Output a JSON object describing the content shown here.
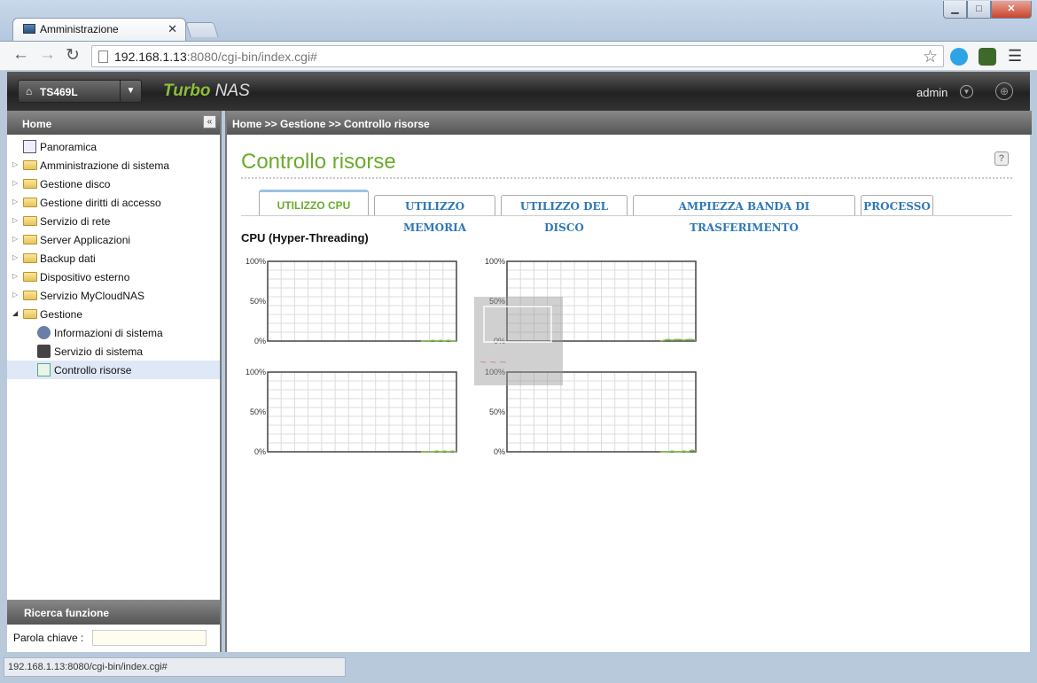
{
  "browser": {
    "tab_title": "Amministrazione",
    "tab_close": "✕",
    "url_host": "192.168.1.13",
    "url_rest": ":8080/cgi-bin/index.cgi#",
    "status_url": "192.168.1.13:8080/cgi-bin/index.cgi#"
  },
  "header": {
    "model": "TS469L",
    "brand_a": "Turbo",
    "brand_b": " NAS",
    "user": "admin"
  },
  "sidebar": {
    "title": "Home",
    "items": [
      {
        "label": "Panoramica"
      },
      {
        "label": "Amministrazione di sistema"
      },
      {
        "label": "Gestione disco"
      },
      {
        "label": "Gestione diritti di accesso"
      },
      {
        "label": "Servizio di rete"
      },
      {
        "label": "Server Applicazioni"
      },
      {
        "label": "Backup dati"
      },
      {
        "label": "Dispositivo esterno"
      },
      {
        "label": "Servizio MyCloudNAS"
      },
      {
        "label": "Gestione"
      },
      {
        "label": "Informazioni di sistema"
      },
      {
        "label": "Servizio di sistema"
      },
      {
        "label": "Controllo risorse"
      }
    ],
    "search_title": "Ricerca funzione",
    "keyword_label": "Parola chiave :"
  },
  "main": {
    "breadcrumb": "Home >> Gestione >> Controllo risorse",
    "title": "Controllo risorse",
    "tabs": [
      {
        "label": "UTILIZZO CPU"
      },
      {
        "label": "UTILIZZO MEMORIA"
      },
      {
        "label": "UTILIZZO DEL DISCO"
      },
      {
        "label": "AMPIEZZA BANDA DI TRASFERIMENTO"
      },
      {
        "label": "PROCESSO"
      }
    ],
    "section": "CPU (Hyper-Threading)"
  },
  "chart_data": {
    "type": "line",
    "title": "CPU (Hyper-Threading)",
    "y_ticks": [
      "100%",
      "50%",
      "0%"
    ],
    "ylim": [
      0,
      100
    ],
    "grid": true,
    "series": [
      {
        "values": [
          0,
          0,
          0,
          1,
          0,
          1,
          0,
          1,
          0,
          0
        ]
      },
      {
        "values": [
          0,
          1,
          2,
          1,
          2,
          2,
          1,
          2,
          2,
          1
        ]
      },
      {
        "values": [
          0,
          0,
          0,
          0,
          1,
          0,
          1,
          0,
          1,
          0
        ]
      },
      {
        "values": [
          0,
          0,
          0,
          1,
          0,
          0,
          1,
          0,
          2,
          1
        ]
      }
    ]
  },
  "colors": {
    "accent_green": "#6bab2b",
    "tab_blue": "#2f78b7",
    "line_green": "#7fc04b"
  }
}
